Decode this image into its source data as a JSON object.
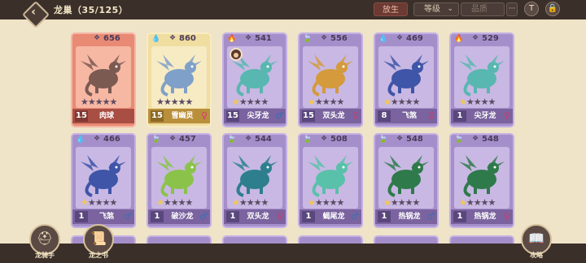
{
  "topbar": {
    "title": "龙巢（35/125）",
    "release_label": "放生",
    "sort_dropdown": "等级",
    "rarity_dropdown": "品质",
    "dots_label": "···",
    "filter_icon": "T",
    "lock_icon": "🔒"
  },
  "colors": {
    "card_purple": "#a58fcb",
    "card_red": "#e98a74",
    "card_gold": "#f0dda0",
    "star_on": "#f3c84d",
    "male": "#3b6fb7",
    "female": "#d03c6b"
  },
  "cards": [
    {
      "element": "none",
      "power": "656",
      "level": "15",
      "name": "肉球",
      "gender": "",
      "stars": 0,
      "rarity": "red",
      "dragon_color": "#7b5a52"
    },
    {
      "element": "water",
      "power": "860",
      "level": "15",
      "name": "雪幽灵",
      "gender": "female",
      "stars": 0,
      "rarity": "gold",
      "dragon_color": "#7fa0c8"
    },
    {
      "element": "fire",
      "power": "541",
      "level": "15",
      "name": "尖牙龙",
      "gender": "male",
      "stars": 1,
      "rarity": "purple",
      "dragon_color": "#58b7b0",
      "avatar": true
    },
    {
      "element": "leaf",
      "power": "556",
      "level": "15",
      "name": "双头龙",
      "gender": "female",
      "stars": 1,
      "rarity": "purple",
      "dragon_color": "#d49a3b"
    },
    {
      "element": "water",
      "power": "469",
      "level": "8",
      "name": "飞煞",
      "gender": "female",
      "stars": 1,
      "rarity": "purple",
      "dragon_color": "#3e55a8"
    },
    {
      "element": "fire",
      "power": "529",
      "level": "1",
      "name": "尖牙龙",
      "gender": "female",
      "stars": 1,
      "rarity": "purple",
      "dragon_color": "#58b7b0"
    },
    {
      "element": "water",
      "power": "466",
      "level": "1",
      "name": "飞煞",
      "gender": "male",
      "stars": 1,
      "rarity": "purple",
      "dragon_color": "#3e55a8"
    },
    {
      "element": "leaf",
      "power": "457",
      "level": "1",
      "name": "破沙龙",
      "gender": "male",
      "stars": 1,
      "rarity": "purple",
      "dragon_color": "#8bc34a"
    },
    {
      "element": "leaf",
      "power": "544",
      "level": "1",
      "name": "双头龙",
      "gender": "female",
      "stars": 1,
      "rarity": "purple",
      "dragon_color": "#2d7f8e"
    },
    {
      "element": "leaf",
      "power": "508",
      "level": "1",
      "name": "蝎尾龙",
      "gender": "male",
      "stars": 1,
      "rarity": "purple",
      "dragon_color": "#59c1a9"
    },
    {
      "element": "leaf",
      "power": "548",
      "level": "1",
      "name": "热锅龙",
      "gender": "male",
      "stars": 1,
      "rarity": "purple",
      "dragon_color": "#2f7a4b"
    },
    {
      "element": "leaf",
      "power": "548",
      "level": "1",
      "name": "热锅龙",
      "gender": "female",
      "stars": 1,
      "rarity": "purple",
      "dragon_color": "#2f7a4b"
    }
  ],
  "bottom": {
    "rider_label": "龙骑手",
    "book_label": "龙之书",
    "guide_label": "攻略"
  }
}
